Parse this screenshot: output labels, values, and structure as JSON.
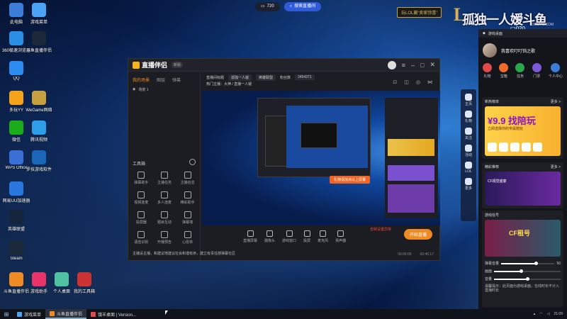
{
  "desktop_icons": [
    {
      "label": "此电脑",
      "icon": "computer-icon",
      "color": "#3b7dd8"
    },
    {
      "label": "游戏菜单",
      "icon": "cloud-icon",
      "color": "#4aa3f5"
    },
    {
      "label": "360极速浏览器",
      "icon": "browser-icon",
      "color": "#2b8fe5"
    },
    {
      "label": "斗鱼直播伴侣",
      "icon": "steam-icon",
      "color": "#1b2838"
    },
    {
      "label": "QQ",
      "icon": "qq-icon",
      "color": "#2d8cf0"
    },
    {
      "label": "多玩YY",
      "icon": "yy-icon",
      "color": "#f6a21a"
    },
    {
      "label": "WeGame网络",
      "icon": "wegame-icon",
      "color": "#c8a040"
    },
    {
      "label": "微信",
      "icon": "wechat-icon",
      "color": "#1aad19"
    },
    {
      "label": "腾讯视频",
      "icon": "tencent-video-icon",
      "color": "#2f9ee8"
    },
    {
      "label": "WPS Office",
      "icon": "wps-icon",
      "color": "#3b6fd8"
    },
    {
      "label": "罗技游戏软件",
      "icon": "logitech-icon",
      "color": "#1a66b8"
    },
    {
      "label": "网易UU加速器",
      "icon": "uu-icon",
      "color": "#2a77e0"
    },
    {
      "label": "英雄联盟",
      "icon": "lol-icon",
      "color": "#14243a"
    },
    {
      "label": "Steam",
      "icon": "steam-icon",
      "color": "#1b2838"
    },
    {
      "label": "斗鱼直播伴侣",
      "icon": "douyu-icon",
      "color": "#f08a24"
    },
    {
      "label": "游戏助手",
      "icon": "bag-icon",
      "color": "#e8336b"
    },
    {
      "label": "个人桌面",
      "icon": "desktop-icon",
      "color": "#4fc3a1"
    },
    {
      "label": "我的工具箱",
      "icon": "toolbox-icon",
      "color": "#cc3333"
    }
  ],
  "topbar": {
    "screen_label": "720",
    "search_label": "搜索直播间"
  },
  "lol_banner": "玩LOL赢“卖家惊喜”",
  "watermark": "孤独一人嫒斗鱼",
  "watermark_sub": "DOUYU.COM",
  "room_no": "020",
  "app": {
    "title": "直播伴侣",
    "version": "新版",
    "left_tabs": [
      "我的场景",
      "图层",
      "弹幕"
    ],
    "scene_label": "场景 1",
    "tools_header": "工具箱",
    "tools": [
      "弹幕助手",
      "主播任务",
      "主播信息",
      "视频连麦",
      "多人连麦",
      "精彩助手",
      "投屏器",
      "题目互动",
      "弹幕墙",
      "语音识别",
      "开播预告",
      "心愿单"
    ],
    "notice": "主播设主播，和建议地建议社会和谐有序，建立有责任感弹幕社区",
    "room_title_label": "直播间标题",
    "room_title": "孤独一人嫒",
    "room_category": "英雄联盟",
    "fan_label": "粉丝数",
    "fan_count": "2454371",
    "tagline": "热门主播：大神  /  直播一人嫒",
    "toast": "礼物请加点以上屏幕",
    "controls": [
      "直播屏幕",
      "摄像头",
      "游戏窗口",
      "投屏",
      "麦克风",
      "扬声器"
    ],
    "warn_text": "音频设置异常",
    "start_button": "开始直播",
    "status": [
      "00:00:00",
      "00:45:17"
    ]
  },
  "side_strip": [
    "主页",
    "礼物",
    "关注",
    "活动",
    "LOL",
    "更多"
  ],
  "rpanel": {
    "title": "游戏桌面",
    "user_name": "我喜欢叮叮铛之歌",
    "actions": [
      {
        "label": "礼物",
        "color": "#e24a4a"
      },
      {
        "label": "宝箱",
        "color": "#f06a2a"
      },
      {
        "label": "任务",
        "color": "#2aa84a"
      },
      {
        "label": "门票",
        "color": "#7a5ad8"
      },
      {
        "label": "个人中心",
        "color": "#3b7dd8"
      }
    ],
    "sec1_title": "新热榜单",
    "sec1_more": "更多 >",
    "ad1_big": "¥9.9 找陪玩",
    "ad1_sub": "立即选择你的专属陪玩",
    "sec2_title": "精彩推荐",
    "sec2_more": "更多 >",
    "ad2_text": "CF视觉盛宴",
    "sec3_title": "游戏信号",
    "ad3_text": "CF租号",
    "sliders": [
      {
        "label": "弹幕音量",
        "value": 0.65
      },
      {
        "label": "画面",
        "value": 0.4
      },
      {
        "label": "音量",
        "value": 0.5
      }
    ],
    "slider_values": [
      "0",
      "50"
    ],
    "footer_note": "温馨提示：此页面为游戏桌面，在线时长不计入直播时长"
  },
  "taskbar": {
    "items": [
      "游戏菜单",
      "斗鱼直播伴侣",
      "饿羊桌面 | Version..."
    ],
    "time": "21:09"
  }
}
